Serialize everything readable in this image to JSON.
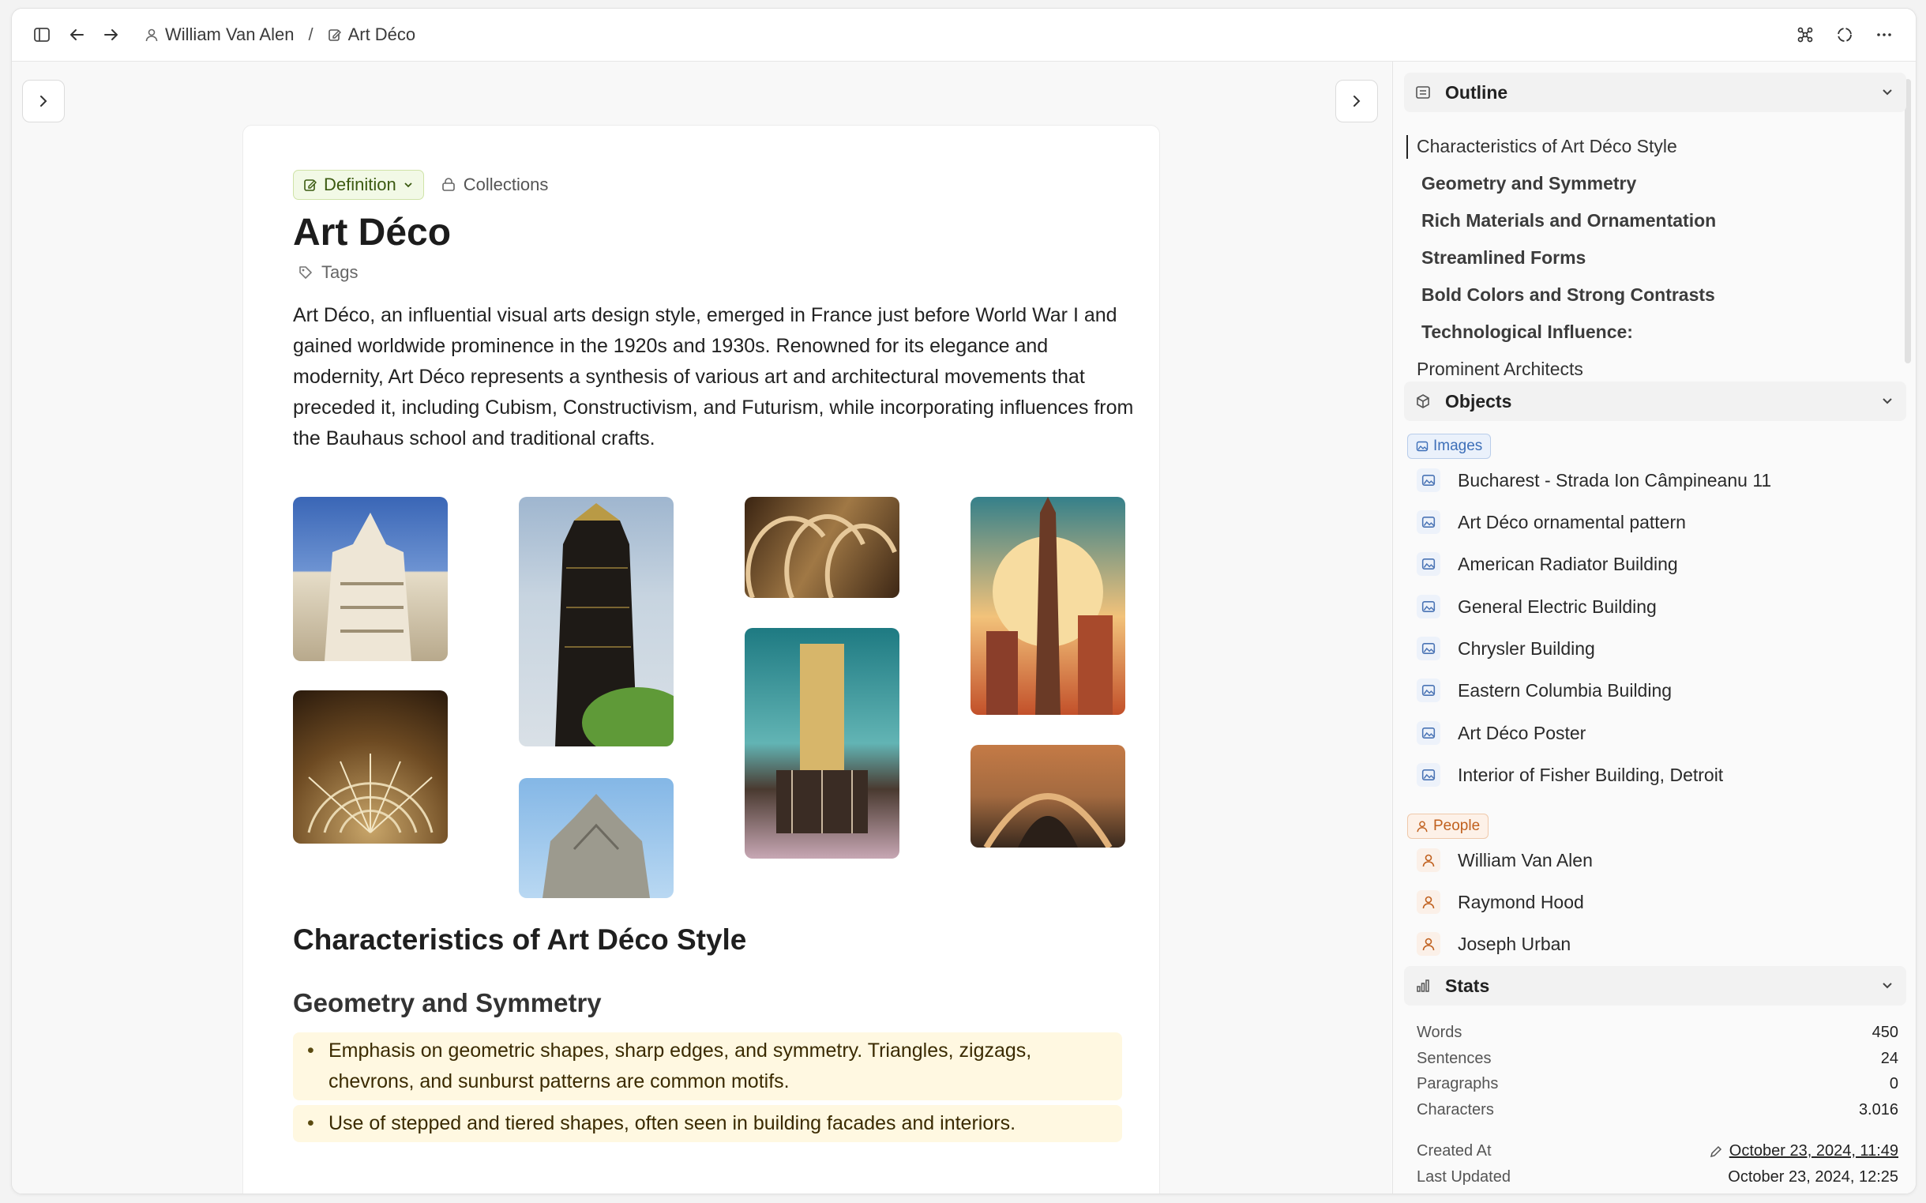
{
  "breadcrumb": {
    "user": "William Van Alen",
    "separator": "/",
    "page": "Art Déco"
  },
  "doc": {
    "type_chip": "Definition",
    "collections_label": "Collections",
    "title": "Art Déco",
    "tags_label": "Tags",
    "intro": "Art Déco, an influential visual arts design style, emerged in France just before World War I and gained worldwide prominence in the 1920s and 1930s. Renowned for its elegance and modernity, Art Déco represents a synthesis of various art and architectural movements that preceded it, including Cubism, Constructivism, and Futurism, while incorporating influences from the Bauhaus school and traditional crafts.",
    "h2": "Characteristics of Art Déco Style",
    "h3": "Geometry and Symmetry",
    "bullets": [
      "Emphasis on geometric shapes, sharp edges, and symmetry. Triangles, zigzags, chevrons, and sunburst patterns are common motifs.",
      "Use of stepped and tiered shapes, often seen in building facades and interiors."
    ]
  },
  "outline": {
    "title": "Outline",
    "items": [
      "Characteristics of Art Déco Style",
      "Geometry and Symmetry",
      "Rich Materials and Ornamentation",
      "Streamlined Forms",
      "Bold Colors and Strong Contrasts",
      "Technological Influence:",
      "Prominent Architects"
    ]
  },
  "objects": {
    "title": "Objects",
    "images_label": "Images",
    "images": [
      "Bucharest - Strada Ion Câmpineanu 11",
      "Art Déco ornamental pattern",
      "American Radiator Building",
      "General Electric Building",
      "Chrysler Building",
      "Eastern Columbia Building",
      "Art Déco Poster",
      "Interior of Fisher Building, Detroit"
    ],
    "people_label": "People",
    "people": [
      "William Van Alen",
      "Raymond Hood",
      "Joseph Urban"
    ]
  },
  "stats": {
    "title": "Stats",
    "words_label": "Words",
    "words": "450",
    "sentences_label": "Sentences",
    "sentences": "24",
    "paragraphs_label": "Paragraphs",
    "paragraphs": "0",
    "characters_label": "Characters",
    "characters": "3.016",
    "created_label": "Created At",
    "created": "October 23, 2024, 11:49",
    "updated_label": "Last Updated",
    "updated": "October 23, 2024, 12:25"
  },
  "colors": {
    "definition_chip_bg": "#f2f9e6",
    "images_badge": "#3d6fb8",
    "people_badge": "#c0601e",
    "bullet_highlight": "#fff8e1"
  }
}
